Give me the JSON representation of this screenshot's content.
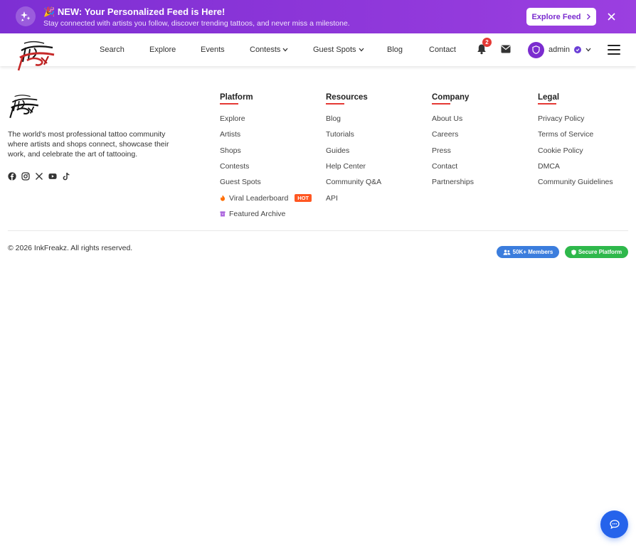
{
  "banner": {
    "emoji": "🎉",
    "title": "NEW: Your Personalized Feed is Here!",
    "subtitle": "Stay connected with artists you follow, discover trending tattoos, and never miss a milestone.",
    "cta_label": "Explore Feed",
    "badge_icon": "sparkles-icon",
    "close_icon": "close-icon"
  },
  "navbar": {
    "links": {
      "search": "Search",
      "explore": "Explore",
      "events": "Events",
      "contests": "Contests",
      "guest_spots": "Guest Spots",
      "blog": "Blog",
      "contact": "Contact"
    },
    "notification_count": "2",
    "user_name": "admin"
  },
  "footer": {
    "about": "The world's most professional tattoo community where artists and shops connect, showcase their work, and celebrate the art of tattooing.",
    "columns": [
      {
        "title": "Platform",
        "items": [
          "Explore",
          "Artists",
          "Shops",
          "Contests",
          "Guest Spots",
          "Viral Leaderboard",
          "Featured Archive"
        ]
      },
      {
        "title": "Resources",
        "items": [
          "Blog",
          "Tutorials",
          "Guides",
          "Help Center",
          "Community Q&A",
          "API"
        ]
      },
      {
        "title": "Company",
        "items": [
          "About Us",
          "Careers",
          "Press",
          "Contact",
          "Partnerships"
        ]
      },
      {
        "title": "Legal",
        "items": [
          "Privacy Policy",
          "Terms of Service",
          "Cookie Policy",
          "DMCA",
          "Community Guidelines"
        ]
      }
    ],
    "hot_badge": "HOT",
    "copyright": "© 2026 InkFreakz. All rights reserved.",
    "members_badge": "50K+ Members",
    "secure_badge": "Secure Platform"
  },
  "colors": {
    "banner_purple": "#8b35d8",
    "accent_red": "#e53935",
    "members_blue": "#3b7ddd",
    "secure_green": "#2eb84b",
    "chat_blue": "#2563eb"
  }
}
